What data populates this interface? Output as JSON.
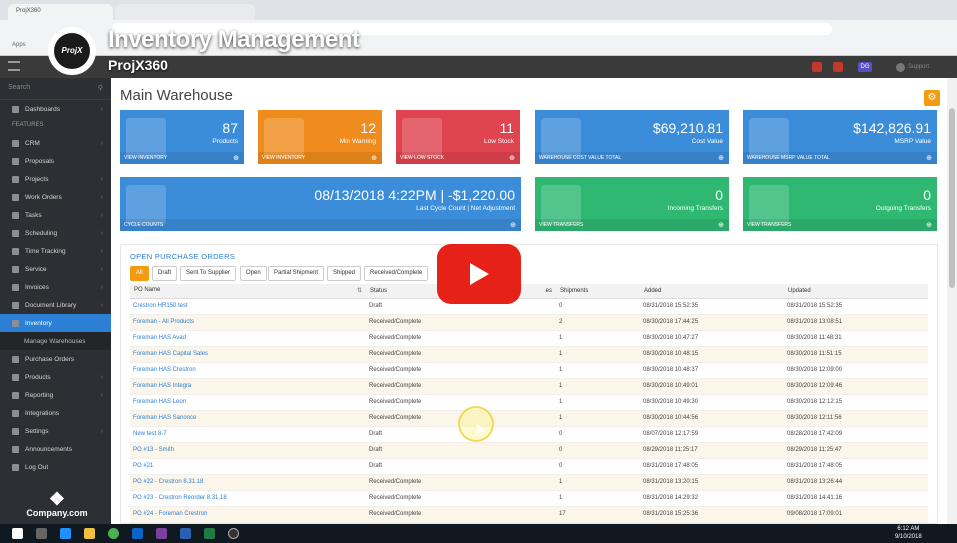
{
  "video": {
    "title": "Inventory Management",
    "subtitle": "ProjX360",
    "logo_text": "ProjX"
  },
  "browser": {
    "tab_title": "ProjX360",
    "bookmarks_label": "Apps"
  },
  "app": {
    "user_initials": "DG",
    "support_label": "Support"
  },
  "sidebar": {
    "search_placeholder": "Search",
    "items": [
      {
        "label": "Dashboards",
        "chev": true
      },
      {
        "label": "FEATURES",
        "section": true
      },
      {
        "label": "CRM",
        "chev": true
      },
      {
        "label": "Proposals",
        "chev": false
      },
      {
        "label": "Projects",
        "chev": true
      },
      {
        "label": "Work Orders",
        "chev": true
      },
      {
        "label": "Tasks",
        "chev": true
      },
      {
        "label": "Scheduling",
        "chev": true
      },
      {
        "label": "Time Tracking",
        "chev": true
      },
      {
        "label": "Service",
        "chev": true
      },
      {
        "label": "Invoices",
        "chev": true
      },
      {
        "label": "Document Library",
        "chev": true
      },
      {
        "label": "Inventory",
        "chev": true,
        "active": true
      },
      {
        "label": "Manage Warehouses",
        "sub": true
      },
      {
        "label": "Purchase Orders",
        "chev": false
      },
      {
        "label": "Products",
        "chev": true
      },
      {
        "label": "Reporting",
        "chev": true
      },
      {
        "label": "Integrations",
        "chev": false
      },
      {
        "label": "Settings",
        "chev": true
      },
      {
        "label": "Announcements",
        "chev": false
      },
      {
        "label": "Log Out",
        "chev": false
      }
    ],
    "footer_logo": "Company.com"
  },
  "page": {
    "title": "Main Warehouse"
  },
  "tiles": {
    "products": {
      "value": "87",
      "label": "Products",
      "link": "VIEW INVENTORY",
      "color": "#3c8dd9"
    },
    "min_warning": {
      "value": "12",
      "label": "Min Warning",
      "link": "VIEW INVENTORY",
      "color": "#f08b1d"
    },
    "low_stock": {
      "value": "11",
      "label": "Low Stock",
      "link": "VIEW LOW STOCK",
      "color": "#e0444f"
    },
    "cost_value": {
      "value": "$69,210.81",
      "label": "Cost Value",
      "link": "WAREHOUSE COST VALUE TOTAL",
      "color": "#3c8dd9"
    },
    "msrp_value": {
      "value": "$142,826.91",
      "label": "MSRP Value",
      "link": "WAREHOUSE MSRP VALUE TOTAL",
      "color": "#3c8dd9"
    },
    "cycle": {
      "value": "08/13/2018 4:22PM | -$1,220.00",
      "label": "Last Cycle Count | Net Adjustment",
      "link": "CYCLE COUNTS",
      "color": "#3c8dd9"
    },
    "incoming": {
      "value": "0",
      "label": "Incoming Transfers",
      "link": "VIEW TRANSFERS",
      "color": "#2eb872"
    },
    "outgoing": {
      "value": "0",
      "label": "Outgoing Transfers",
      "link": "VIEW TRANSFERS",
      "color": "#2eb872"
    }
  },
  "orders": {
    "title": "OPEN PURCHASE ORDERS",
    "filters": [
      "All",
      "Draft",
      "Sent To Supplier",
      "Open",
      "Partial Shipment",
      "Shipped",
      "Received/Complete"
    ],
    "columns": [
      "PO Name",
      "Status",
      "es",
      "Shipments",
      "Added",
      "Updated"
    ],
    "rows": [
      {
        "name": "Crestron HR150 test",
        "status": "Draft",
        "shipments": "0",
        "added": "08/31/2018 15:52:35",
        "updated": "08/31/2018 15:52:35"
      },
      {
        "name": "Foreman - All Products",
        "status": "Received/Complete",
        "shipments": "2",
        "added": "08/30/2018 17:44:25",
        "updated": "08/31/2018 13:08:51"
      },
      {
        "name": "Foreman HAS Avad",
        "status": "Received/Complete",
        "shipments": "1",
        "added": "08/30/2018 10:47:27",
        "updated": "08/30/2018 11:48:31"
      },
      {
        "name": "Foreman HAS Capital Sales",
        "status": "Received/Complete",
        "shipments": "1",
        "added": "08/30/2018 10:48:15",
        "updated": "08/30/2018 11:51:15"
      },
      {
        "name": "Foreman HAS Crestron",
        "status": "Received/Complete",
        "shipments": "1",
        "added": "08/30/2018 10:48:37",
        "updated": "08/30/2018 12:09:00"
      },
      {
        "name": "Foreman HAS Integra",
        "status": "Received/Complete",
        "shipments": "1",
        "added": "08/30/2018 10:49:01",
        "updated": "08/30/2018 12:09:46"
      },
      {
        "name": "Foreman HAS Leon",
        "status": "Received/Complete",
        "shipments": "1",
        "added": "08/30/2018 10:49:30",
        "updated": "08/30/2018 12:12:15"
      },
      {
        "name": "Foreman HAS Sanonce",
        "status": "Received/Complete",
        "shipments": "1",
        "added": "08/30/2018 10:44:56",
        "updated": "08/30/2018 12:11:56"
      },
      {
        "name": "New test 8-7",
        "status": "Draft",
        "shipments": "0",
        "added": "08/07/2018 12:17:59",
        "updated": "08/28/2018 17:42:09"
      },
      {
        "name": "PO #13 - Smith",
        "status": "Draft",
        "shipments": "0",
        "added": "08/29/2018 11:25:17",
        "updated": "08/29/2018 11:25:47"
      },
      {
        "name": "PO #21",
        "status": "Draft",
        "shipments": "0",
        "added": "08/31/2018 17:48:05",
        "updated": "08/31/2018 17:48:05"
      },
      {
        "name": "PO #22 - Crestron 8.31.18",
        "status": "Received/Complete",
        "shipments": "1",
        "added": "08/31/2018 13:20:15",
        "updated": "08/31/2018 13:26:44"
      },
      {
        "name": "PO #23 - Crestron Reorder 8.31.18",
        "status": "Received/Complete",
        "shipments": "1",
        "added": "08/31/2018 14:29:32",
        "updated": "08/31/2018 14:41:16"
      },
      {
        "name": "PO #24 - Foreman Crestron",
        "status": "Received/Complete",
        "shipments": "17",
        "added": "08/31/2018 15:25:36",
        "updated": "09/08/2018 17:09:01"
      }
    ]
  },
  "taskbar": {
    "time": "6:12 AM",
    "date": "9/10/2018"
  }
}
